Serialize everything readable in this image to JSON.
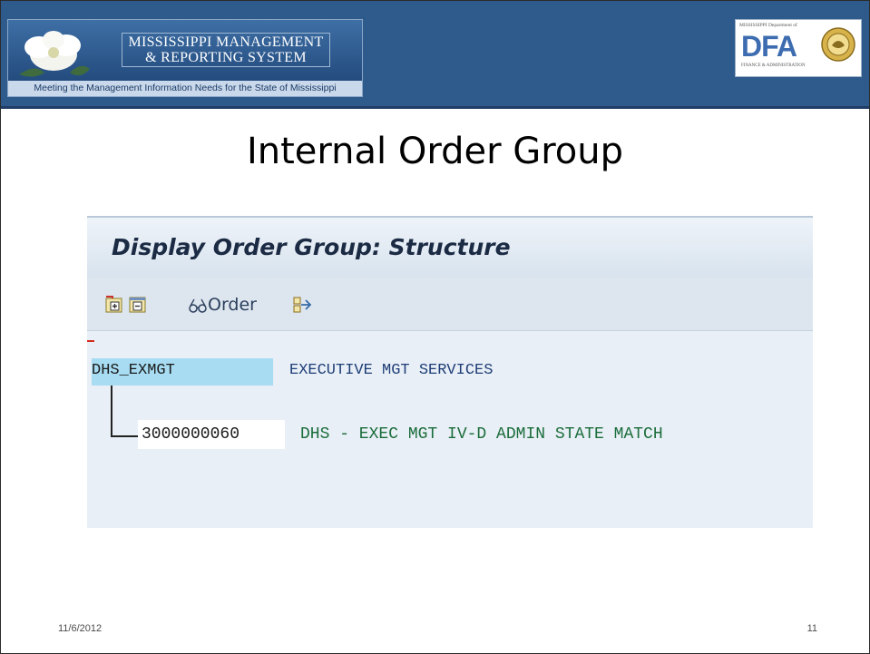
{
  "header": {
    "logo_title_line1": "MISSISSIPPI MANAGEMENT",
    "logo_title_line2": "& REPORTING SYSTEM",
    "logo_tagline": "Meeting the Management Information Needs for the State of Mississippi",
    "dfa_top": "MISSISSIPPI Department of",
    "dfa_letters": "DFA",
    "dfa_sub": "FINANCE & ADMINISTRATION"
  },
  "slide": {
    "title": "Internal Order Group",
    "date": "11/6/2012",
    "page_number": "11"
  },
  "sap": {
    "screen_title": "Display Order Group: Structure",
    "toolbar": {
      "order_label": "Order"
    },
    "tree": {
      "root": {
        "id": "DHS_EXMGT",
        "description": "EXECUTIVE MGT SERVICES"
      },
      "children": [
        {
          "id": "3000000060",
          "description": "DHS - EXEC MGT IV-D ADMIN STATE MATCH"
        }
      ]
    }
  },
  "colors": {
    "header_bg": "#2f5a8c",
    "selection_bg": "#a7dcf2",
    "root_desc_color": "#1f3e77",
    "child_desc_color": "#1b6d3b"
  }
}
